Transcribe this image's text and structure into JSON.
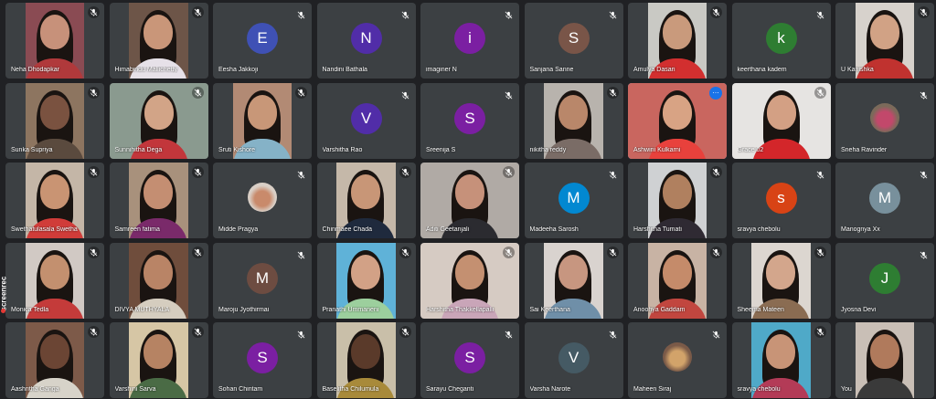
{
  "watermark": {
    "brand": "screenrec",
    "dot_color": "#e53935"
  },
  "participants": [
    {
      "name": "Neha Dhodapkar",
      "kind": "video",
      "bg": "#8a4b53",
      "body": "#b0393b",
      "skin": "#c7917a",
      "mic": "muted"
    },
    {
      "name": "Himabindu Mallichetty",
      "kind": "video",
      "bg": "#6d5548",
      "body": "#e6e1e8",
      "skin": "#c99679",
      "mic": "muted"
    },
    {
      "name": "Eesha Jakkoji",
      "kind": "letter",
      "letter": "E",
      "color": "#3f51b5",
      "mic": "muted"
    },
    {
      "name": "Nandini Bathala",
      "kind": "letter",
      "letter": "N",
      "color": "#512da8",
      "mic": "muted"
    },
    {
      "name": "imaginer N",
      "kind": "letter",
      "letter": "i",
      "color": "#7b1fa2",
      "mic": "muted"
    },
    {
      "name": "Sanjana Sanne",
      "kind": "letter",
      "letter": "S",
      "color": "#795548",
      "mic": "muted"
    },
    {
      "name": "Amulya Dasari",
      "kind": "video",
      "bg": "#c9c9c4",
      "body": "#d22f2f",
      "skin": "#c99a7c",
      "mic": "muted"
    },
    {
      "name": "keerthana kadem",
      "kind": "letter",
      "letter": "k",
      "color": "#2e7d32",
      "mic": "muted"
    },
    {
      "name": "U Kanishka",
      "kind": "video",
      "bg": "#d7d2cc",
      "body": "#c0322f",
      "skin": "#d1a285",
      "mic": "muted"
    },
    {
      "name": "Sunka Supriya",
      "kind": "video",
      "bg": "#8d7560",
      "body": "#5a4a3e",
      "skin": "#7a5240",
      "mic": "muted"
    },
    {
      "name": "Sunnihitha Dega",
      "kind": "video",
      "bg": "#8a9a8f",
      "body": "#c2363b",
      "skin": "#d2a487",
      "mic": "muted"
    },
    {
      "name": "Sruti Kishore",
      "kind": "video",
      "bg": "#b28a74",
      "body": "#85b2c7",
      "skin": "#c89778",
      "mic": "muted"
    },
    {
      "name": "Varshitha Rao",
      "kind": "letter",
      "letter": "V",
      "color": "#512da8",
      "mic": "muted"
    },
    {
      "name": "Sreenija S",
      "kind": "letter",
      "letter": "S",
      "color": "#7b1fa2",
      "mic": "muted"
    },
    {
      "name": "nikitha reddy",
      "kind": "video",
      "bg": "#b8b3ad",
      "body": "#7a6c66",
      "skin": "#b9876a",
      "mic": "muted"
    },
    {
      "name": "Ashwini Kulkarni",
      "kind": "video",
      "bg": "#c9665f",
      "body": "#e8413c",
      "skin": "#d8a384",
      "mic": "more",
      "pinned": true
    },
    {
      "name": "Grace 02",
      "kind": "video",
      "bg": "#e6e4e2",
      "body": "#d3262a",
      "skin": "#d3a084",
      "mic": "muted"
    },
    {
      "name": "Sneha Ravinder",
      "kind": "photo",
      "photo_bg": "#7b6a5a",
      "photo_fg": "#c2486b",
      "mic": "muted"
    },
    {
      "name": "Swethatulasala Swetha",
      "kind": "video",
      "bg": "#c4b6a7",
      "body": "#d03c39",
      "skin": "#c99473",
      "mic": "muted"
    },
    {
      "name": "Samreen fatima",
      "kind": "video",
      "bg": "#a8917c",
      "body": "#7a2a6a",
      "skin": "#c48e72",
      "mic": "muted"
    },
    {
      "name": "Midde Pragya",
      "kind": "photo",
      "photo_bg": "#d9cfc6",
      "photo_fg": "#c98a6b",
      "mic": "muted"
    },
    {
      "name": "Chinmaee Chada",
      "kind": "video",
      "bg": "#c5b8a9",
      "body": "#1f2a3d",
      "skin": "#c89677",
      "mic": "muted"
    },
    {
      "name": "Aditi Geetanjali",
      "kind": "video",
      "bg": "#b0aaa5",
      "body": "#2b2b30",
      "skin": "#c6917a",
      "mic": "muted"
    },
    {
      "name": "Madeeha Sarosh",
      "kind": "letter",
      "letter": "M",
      "color": "#0288d1",
      "mic": "muted"
    },
    {
      "name": "Harshitha Tumati",
      "kind": "video",
      "bg": "#cfd1d3",
      "body": "#2f2a33",
      "skin": "#b0805f",
      "mic": "muted"
    },
    {
      "name": "sravya chebolu",
      "kind": "letter",
      "letter": "s",
      "color": "#d84315",
      "mic": "muted"
    },
    {
      "name": "Manognya Xx",
      "kind": "letter",
      "letter": "M",
      "color": "#78909c",
      "mic": "muted"
    },
    {
      "name": "Monica Tedla",
      "kind": "video",
      "bg": "#d1c9c4",
      "body": "#c43b3a",
      "skin": "#c3906f",
      "mic": "muted"
    },
    {
      "name": "DIVYA MUTHYALA",
      "kind": "video",
      "bg": "#6f4d3c",
      "body": "#d5cdbf",
      "skin": "#b98466",
      "mic": "muted"
    },
    {
      "name": "Maroju Jyothirmai",
      "kind": "letter",
      "letter": "M",
      "color": "#6d4c41",
      "mic": "muted"
    },
    {
      "name": "Pranathi Ummaneni",
      "kind": "video",
      "bg": "#5fb2d8",
      "body": "#9ccf9d",
      "skin": "#d2a186",
      "mic": "muted"
    },
    {
      "name": "Harshitha Thakkellapalli",
      "kind": "video",
      "bg": "#d6cbc3",
      "body": "#c9a5b8",
      "skin": "#c49071",
      "mic": "muted"
    },
    {
      "name": "Sai Keerthana",
      "kind": "video",
      "bg": "#d9d3cf",
      "body": "#6f8fa8",
      "skin": "#c79680",
      "mic": "muted"
    },
    {
      "name": "Anoohya Gaddam",
      "kind": "video",
      "bg": "#c8b3a4",
      "body": "#c1463f",
      "skin": "#c58b6a",
      "mic": "muted"
    },
    {
      "name": "Sheema Mateen",
      "kind": "video",
      "bg": "#dcd6d0",
      "body": "#8a6c52",
      "skin": "#d3a68c",
      "mic": "muted"
    },
    {
      "name": "Jyosna Devi",
      "kind": "letter",
      "letter": "J",
      "color": "#2e7d32",
      "mic": "muted"
    },
    {
      "name": "Aashritha Ganga",
      "kind": "video",
      "bg": "#7d5a49",
      "body": "#d7d3c9",
      "skin": "#6b4534",
      "mic": "muted"
    },
    {
      "name": "Varshini Sarva",
      "kind": "video",
      "bg": "#d6c6a5",
      "body": "#4a6b45",
      "skin": "#b68363",
      "mic": "muted"
    },
    {
      "name": "Sohan Chintam",
      "kind": "letter",
      "letter": "S",
      "color": "#7b1fa2",
      "mic": "muted"
    },
    {
      "name": "Baselitha Chilumula",
      "kind": "video",
      "bg": "#c9bfa9",
      "body": "#a88a3a",
      "skin": "#5a3a2a",
      "mic": "muted"
    },
    {
      "name": "Sarayu Cheganti",
      "kind": "letter",
      "letter": "S",
      "color": "#7b1fa2",
      "mic": "muted"
    },
    {
      "name": "Varsha Narote",
      "kind": "letter",
      "letter": "V",
      "color": "#455a64",
      "mic": "muted"
    },
    {
      "name": "Maheen Siraj",
      "kind": "photo",
      "photo_bg": "#7a5a48",
      "photo_fg": "#d2a36a",
      "mic": "muted"
    },
    {
      "name": "sravya chebolu",
      "kind": "video",
      "bg": "#4fa9c8",
      "body": "#b33b57",
      "skin": "#c89477",
      "mic": "muted"
    },
    {
      "name": "You",
      "kind": "video",
      "bg": "#c9bfb6",
      "body": "#3a3a3a",
      "skin": "#b07a5c",
      "mic": "none"
    }
  ]
}
